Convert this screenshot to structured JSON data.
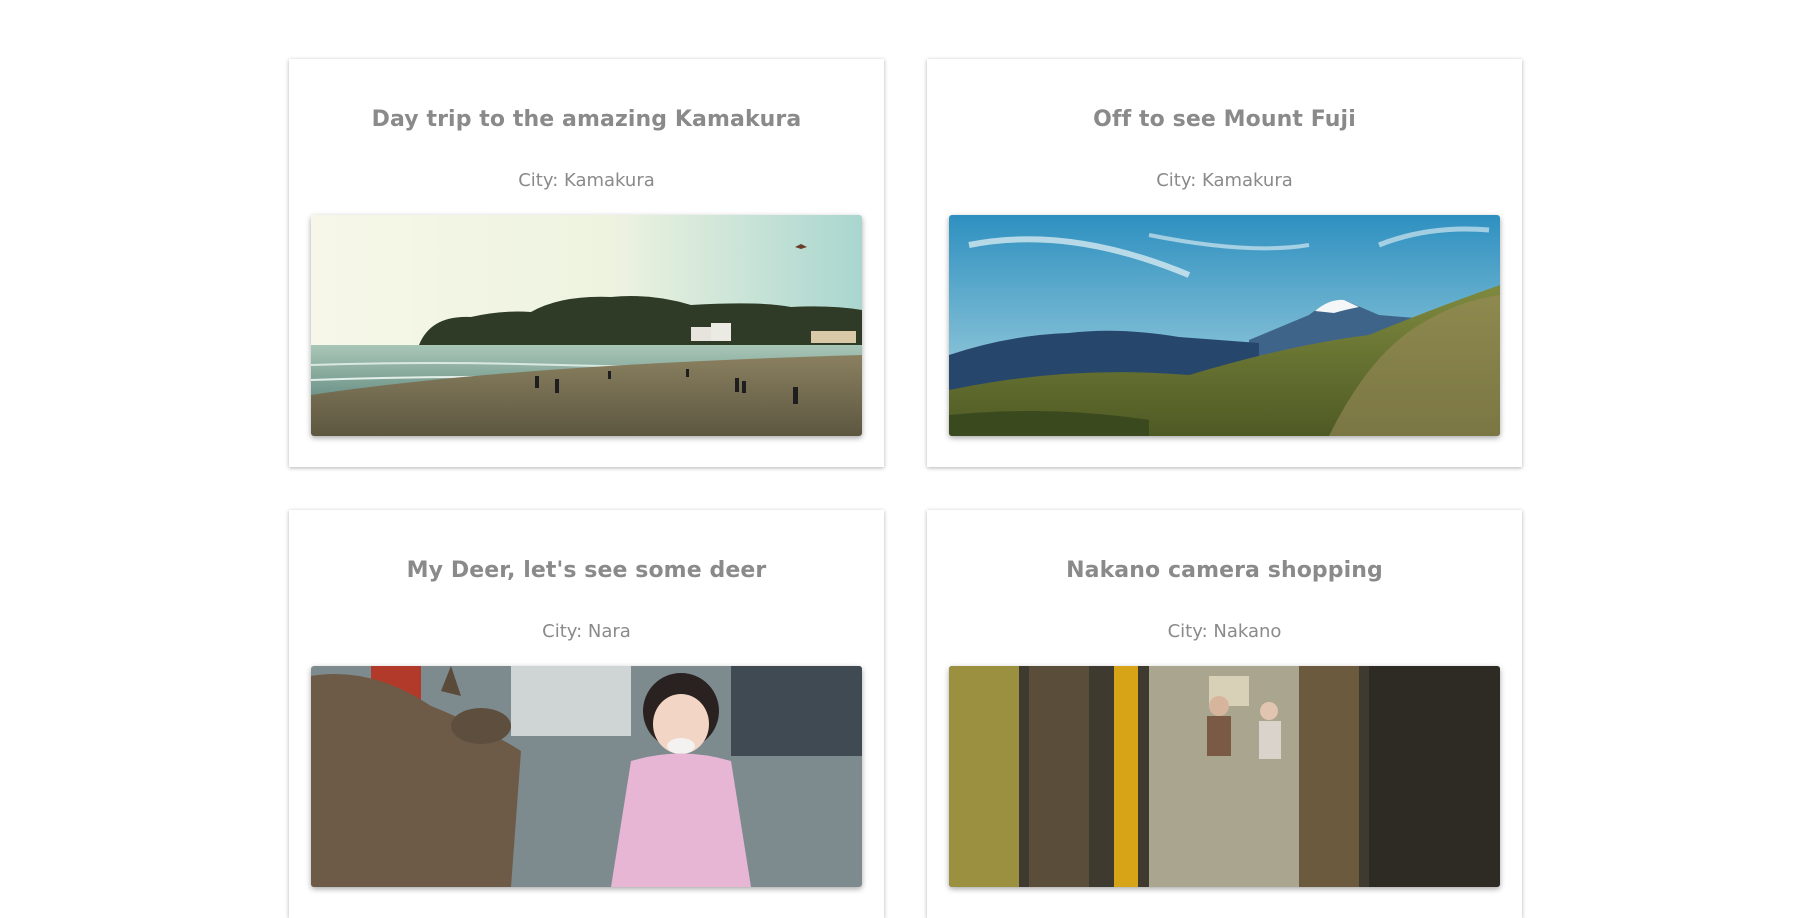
{
  "cards": [
    {
      "title": "Day trip to the amazing Kamakura",
      "city": "City: Kamakura",
      "image": "beach-coastline-photo"
    },
    {
      "title": "Off to see Mount Fuji",
      "city": "City: Kamakura",
      "image": "mount-fuji-landscape-photo"
    },
    {
      "title": "My Deer, let's see some deer",
      "city": "City: Nara",
      "image": "deer-and-child-photo"
    },
    {
      "title": "Nakano camera shopping",
      "city": "City: Nakano",
      "image": "nakano-street-photo"
    }
  ]
}
